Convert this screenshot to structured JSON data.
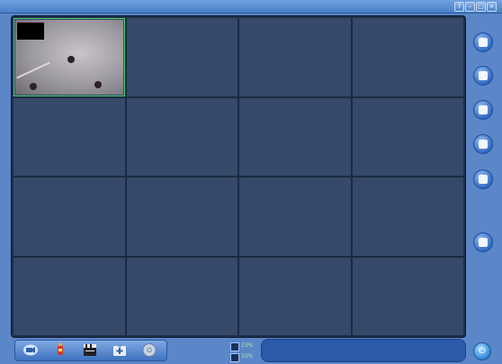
{
  "window": {
    "title": "",
    "buttons": [
      "help",
      "minimize",
      "maximize",
      "close"
    ]
  },
  "video": {
    "rows": 4,
    "cols": 4,
    "active_cell": 0,
    "timestamp": ""
  },
  "side_buttons": [
    {
      "name": "remote-playback-icon"
    },
    {
      "name": "camera-dome-icon"
    },
    {
      "name": "monitor-config-icon"
    },
    {
      "name": "globe-network-icon"
    },
    {
      "name": "record-manager-icon"
    },
    {
      "name": "screen-switch-icon"
    }
  ],
  "toolbar": [
    {
      "name": "camera-icon"
    },
    {
      "name": "bottle-icon"
    },
    {
      "name": "clapperboard-icon"
    },
    {
      "name": "first-aid-icon"
    },
    {
      "name": "disk-icon"
    }
  ],
  "status": {
    "cpu_percent": "23%",
    "mem_percent": "10%",
    "messages": [
      "",
      ""
    ]
  },
  "colors": {
    "titlebar": "#4a7fc6",
    "background": "#5b86c7",
    "grid_cell": "#35496a",
    "active_border": "#4ad06a",
    "status_bg": "#2c5aa8"
  }
}
